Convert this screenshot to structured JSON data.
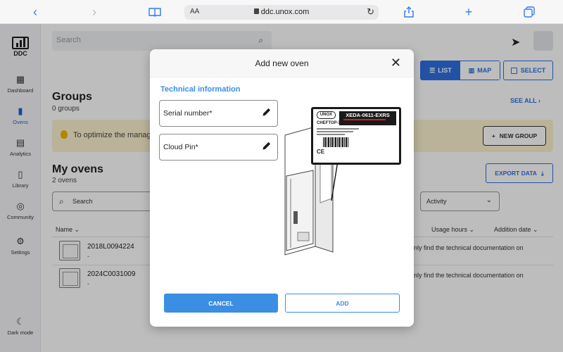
{
  "browser": {
    "back_icon": "chevron-left-icon",
    "forward_icon": "chevron-right-icon",
    "text_size_label": "AA",
    "url": "ddc.unox.com",
    "reload_icon": "reload-icon",
    "actions": [
      "book-icon",
      "share-icon",
      "plus-icon",
      "tabs-icon"
    ]
  },
  "sidebar": {
    "logo_text": "DDC",
    "items": [
      {
        "label": "Dashboard",
        "icon": "dashboard-icon"
      },
      {
        "label": "Ovens",
        "icon": "oven-icon",
        "active": true
      },
      {
        "label": "Analytics",
        "icon": "analytics-icon"
      },
      {
        "label": "Library",
        "icon": "library-icon"
      },
      {
        "label": "Community",
        "icon": "community-icon"
      },
      {
        "label": "Settings",
        "icon": "settings-icon"
      }
    ],
    "dark_mode_label": "Dark mode"
  },
  "header": {
    "search_placeholder": "Search"
  },
  "view_toggle": {
    "list_label": "LIST",
    "map_label": "MAP",
    "select_label": "SELECT"
  },
  "groups": {
    "title": "Groups",
    "count": "0 groups",
    "see_all": "SEE ALL",
    "banner_text": "To optimize the manage",
    "new_group_label": "NEW GROUP"
  },
  "ovens": {
    "title": "My ovens",
    "count": "2 ovens",
    "export_label": "EXPORT DATA",
    "search_placeholder": "Search",
    "sort_value": "Activity",
    "columns": {
      "name": "Name",
      "usage_hours": "Usage hours",
      "addition_date": "Addition date"
    },
    "rows": [
      {
        "serial": "2018L0094224",
        "sub": "-",
        "note": "will only find the technical documentation on"
      },
      {
        "serial": "2024C0031009",
        "sub": "-",
        "note": "will only find the technical documentation on"
      }
    ]
  },
  "modal": {
    "title": "Add new oven",
    "section_title": "Technical information",
    "fields": {
      "serial_label": "Serial number*",
      "pin_label": "Cloud Pin*"
    },
    "label_card": {
      "brand": "UNOX",
      "serial": "XEDA-0611-EXRS",
      "model": "CHEFTOP-X"
    },
    "cancel_label": "CANCEL",
    "add_label": "ADD"
  },
  "colors": {
    "accent": "#3b8ee3",
    "primary": "#2d6fe0",
    "banner_bg": "#fdf2cf"
  }
}
